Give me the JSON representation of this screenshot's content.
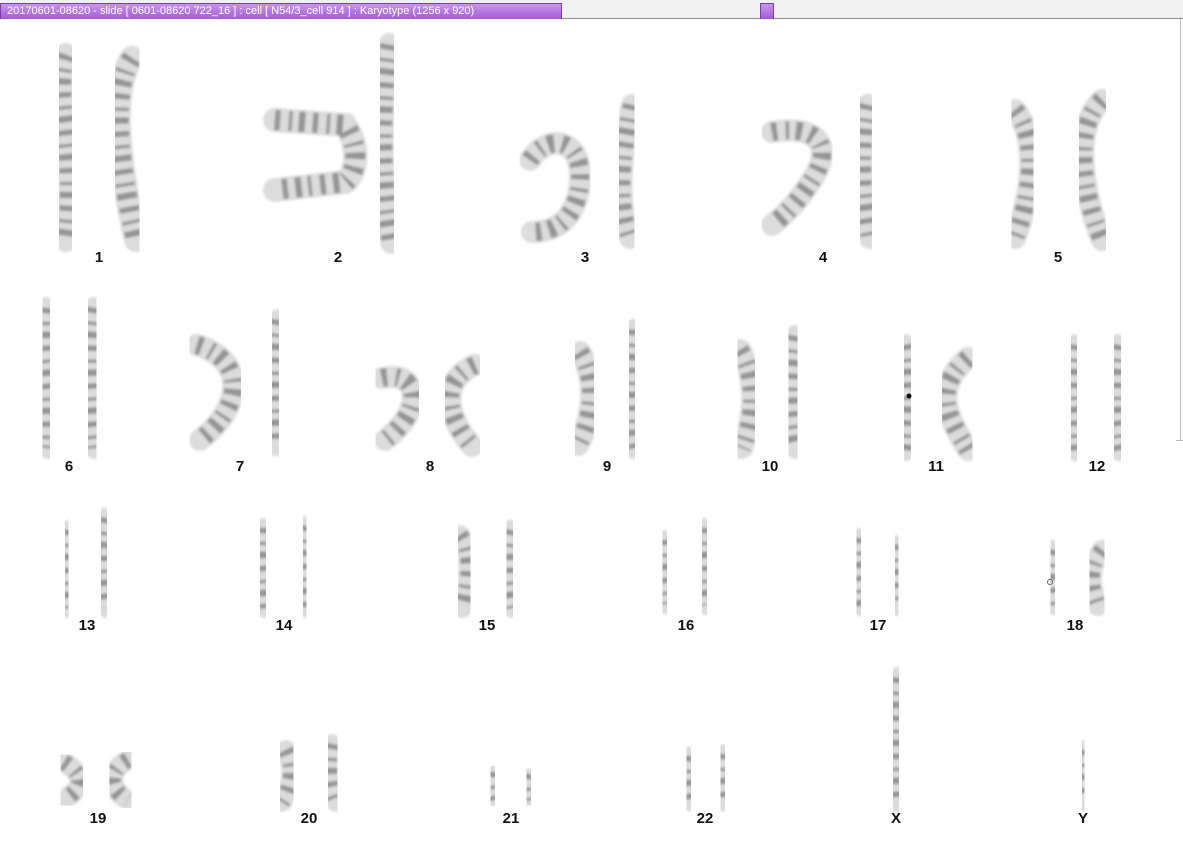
{
  "window": {
    "title": "20170601-08620 - slide [ 0601-08620 722_16 ] : cell [ N54/3_cell 914 ] : Karyotype  (1256 x 920)"
  },
  "karyotype": {
    "chromosomes": [
      {
        "label": "1"
      },
      {
        "label": "2"
      },
      {
        "label": "3"
      },
      {
        "label": "4"
      },
      {
        "label": "5"
      },
      {
        "label": "6"
      },
      {
        "label": "7"
      },
      {
        "label": "8"
      },
      {
        "label": "9"
      },
      {
        "label": "10"
      },
      {
        "label": "11"
      },
      {
        "label": "12"
      },
      {
        "label": "13"
      },
      {
        "label": "14"
      },
      {
        "label": "15"
      },
      {
        "label": "16"
      },
      {
        "label": "17"
      },
      {
        "label": "18"
      },
      {
        "label": "19"
      },
      {
        "label": "20"
      },
      {
        "label": "21"
      },
      {
        "label": "22"
      },
      {
        "label": "X"
      },
      {
        "label": "Y"
      }
    ]
  },
  "colors": {
    "title_tab": "#b070e0",
    "chromosome_light": "#dcdcdc",
    "chromosome_dark": "#6e6e6e",
    "label": "#111111"
  }
}
